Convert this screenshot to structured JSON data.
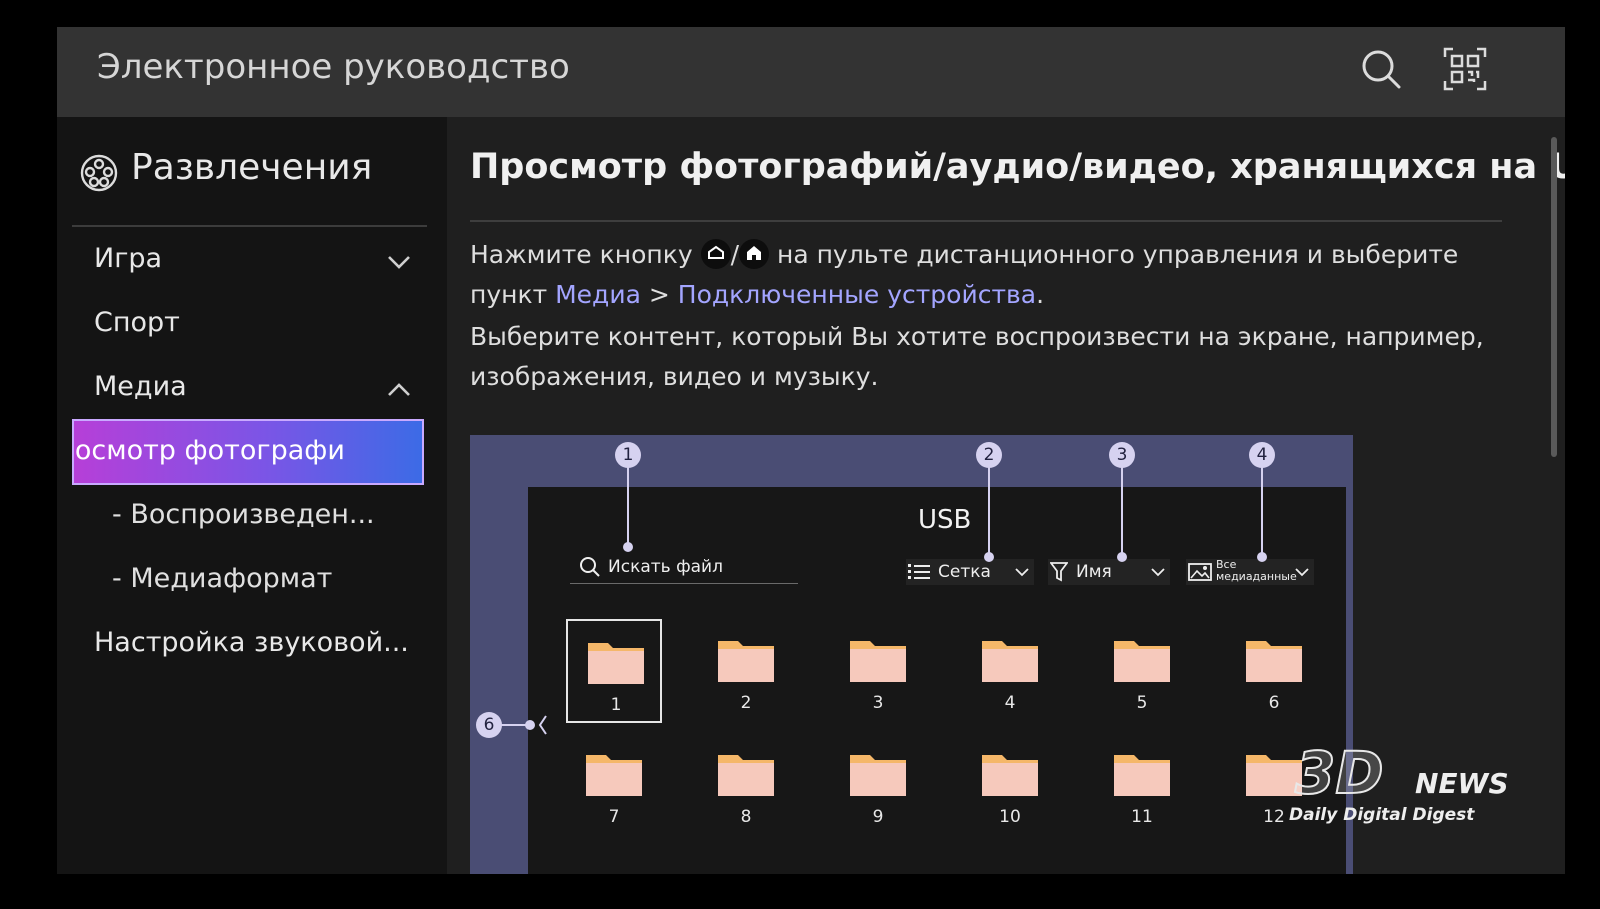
{
  "header": {
    "title": "Электронное руководство",
    "search_icon": "search-icon",
    "qr_icon": "qr-code-icon"
  },
  "sidebar": {
    "category": {
      "icon": "film-reel-icon",
      "label": "Развлечения"
    },
    "items": [
      {
        "label": "Игра",
        "expanded": false
      },
      {
        "label": "Спорт"
      },
      {
        "label": "Медиа",
        "expanded": true
      },
      {
        "label": "Настройка звуковой..."
      }
    ],
    "sub_items": [
      {
        "label": "Просмотр фотографий",
        "visible_text": "ɔосмотр фотографи",
        "active": true
      },
      {
        "label": "- Воспроизведен..."
      },
      {
        "label": "- Медиаформат"
      }
    ]
  },
  "content": {
    "title": "Просмотр фотографий/аудио/видео, хранящихся на US...",
    "para1": {
      "before": "Нажмите кнопку",
      "separator": "/",
      "after": "на пульте дистанционного управления и выберите",
      "line2_prefix": "пункт",
      "link1": "Медиа",
      "arrow": ">",
      "link2": "Подключенные устройства",
      "end": "."
    },
    "para2": "Выберите контент, который Вы хотите воспроизвести на экране, например, изображения, видео и музыку."
  },
  "figure": {
    "title": "USB",
    "search_placeholder": "Искать файл",
    "view_option": "Сетка",
    "sort_option": "Имя",
    "filter_option_line1": "Все",
    "filter_option_line2": "медиаданные",
    "callouts": [
      "1",
      "2",
      "3",
      "4",
      "6"
    ],
    "folders": [
      "1",
      "2",
      "3",
      "4",
      "5",
      "6",
      "7",
      "8",
      "9",
      "10",
      "11",
      "12"
    ],
    "colors": {
      "folder": "#f6c9bc",
      "folder_tab": "#f5b769",
      "callout": "#d6d2f0",
      "frame": "#4a4d74"
    }
  },
  "watermark": {
    "brand_big": "3D",
    "brand_news": "NEWS",
    "tagline": "Daily Digital Digest"
  },
  "colors": {
    "accent_gradient_start": "#b63fd8",
    "accent_gradient_end": "#3c6be6",
    "link": "#a3a5ff"
  }
}
